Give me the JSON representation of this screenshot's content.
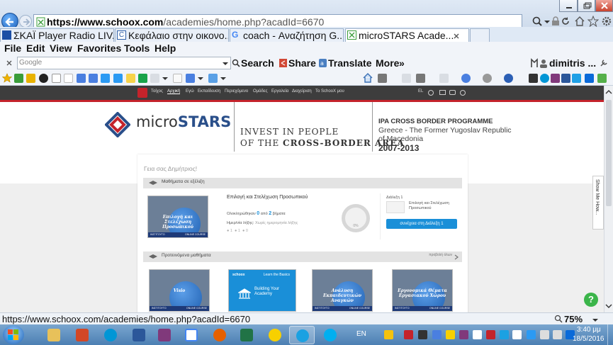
{
  "browser": {
    "url_host": "https://www.schoox.com",
    "url_path": "/academies/home.php?acadId=6670",
    "tabs": [
      {
        "label": "ΣΚΑΪ Player Radio LIV...",
        "favicon_color": "#1d4fa5",
        "active": false
      },
      {
        "label": "Κεφάλαιο στην οικονο...",
        "favicon_color": "#2f5fa7",
        "active": false
      },
      {
        "label": "coach - Αναζήτηση G...",
        "favicon_color": "#4285f4",
        "active": false
      },
      {
        "label": "microSTARS Acade...",
        "favicon_color": "#3a9d3a",
        "active": true
      }
    ],
    "menu": [
      "File",
      "Edit",
      "View",
      "Favorites",
      "Tools",
      "Help"
    ],
    "google_toolbar": {
      "logo": "Google",
      "search_label": "Search",
      "share_label": "Share",
      "translate_label": "Translate",
      "more_label": "More",
      "user": "dimitris ..."
    },
    "status_url": "https://www.schoox.com/academies/home.php?acadId=6670",
    "zoom": "75%"
  },
  "site": {
    "nav": [
      "Τοίχος",
      "Αρχική",
      "Εγώ",
      "Εκπαίδευση",
      "Περιεχόμενο",
      "Ομάδες",
      "Εργαλεία",
      "Διαχείριση",
      "Το SchooX μου"
    ],
    "nav_right": "EL",
    "logo_text_light": "micro",
    "logo_text_bold": "STARS",
    "slogan_line1": "INVEST IN PEOPLE",
    "slogan_line2_prefix": "OF THE ",
    "slogan_line2_bold": "CROSS-BORDER AREA",
    "programme_title": "IPA CROSS BORDER PROGRAMME",
    "programme_sub1": "Greece - The Former Yugoslav Republic",
    "programme_sub2": "of Macedonia",
    "programme_years": "2007-2013",
    "show_me_how": "Show Me How..."
  },
  "dashboard": {
    "greeting": "Γεια σας Δημήτριος!",
    "in_progress_title": "Μαθήματα σε εξέλιξη",
    "course": {
      "title": "Επιλογή και Στελέχωση Προσωπικού",
      "thumb_title": "Επιλογή και Στελέχωση Προσωπικού",
      "completed_prefix": "Ολοκληρώθηκαν",
      "completed": "0",
      "of_label": "από",
      "total": "2",
      "unit": "βήματα",
      "deadline_label": "Ημερ/νία λήξης:",
      "deadline_value": "Χωρίς ημερομηνία λήξης",
      "stats": [
        "1",
        "1",
        "0"
      ],
      "progress_label": "0%",
      "lecture_title": "Διάλεξη 1",
      "lecture_sub": "Επιλογή και Στελέχωση Προσωπικού",
      "continue_button": "συνέχεια στη Διάλεξη 1"
    },
    "recommended_title": "Προτεινόμενα μαθήματα",
    "see_all": "προβολή όλων",
    "recommended": [
      {
        "title": "Visio",
        "style": "photo"
      },
      {
        "title": "Building Your Academy",
        "brand": "schoox",
        "kicker": "Learn the Basics",
        "style": "blue"
      },
      {
        "title": "Ανάλυση Εκπαιδευτικών Αναγκών",
        "style": "photo"
      },
      {
        "title": "Εργονομικά Θέματα Εργασιακού Χώρου",
        "style": "photo"
      }
    ],
    "thumb_band_left": "ΙΝΣΤΙΤΟΥΤΟ",
    "thumb_band_right": "ONLINE COURSE",
    "accent": "#1a8fd8"
  },
  "taskbar": {
    "lang": "EN",
    "time": "3:40 μμ",
    "date": "18/5/2016"
  }
}
